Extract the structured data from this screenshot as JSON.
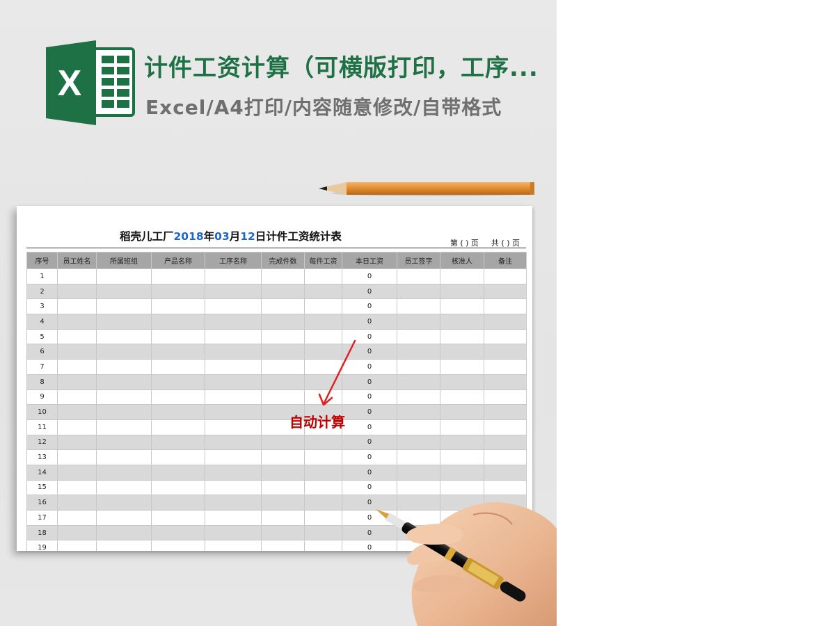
{
  "header": {
    "logo_letter": "X",
    "title": "计件工资计算（可横版打印，工序...",
    "subtitle": "Excel/A4打印/内容随意修改/自带格式"
  },
  "sheet": {
    "title_parts": {
      "prefix": "稻壳儿工厂",
      "year": "2018",
      "year_unit": "年",
      "month": "03",
      "month_unit": "月",
      "day": "12",
      "suffix": "日计件工资统计表"
    },
    "page_label": "第 ( ) 页",
    "total_label": "共 ( ) 页",
    "columns": [
      "序号",
      "员工姓名",
      "所属班组",
      "产品名称",
      "工序名称",
      "完成件数",
      "每件工资",
      "本日工资",
      "员工签字",
      "核准人",
      "备注"
    ],
    "rows": [
      {
        "no": "1",
        "wage": "0"
      },
      {
        "no": "2",
        "wage": "0"
      },
      {
        "no": "3",
        "wage": "0"
      },
      {
        "no": "4",
        "wage": "0"
      },
      {
        "no": "5",
        "wage": "0"
      },
      {
        "no": "6",
        "wage": "0"
      },
      {
        "no": "7",
        "wage": "0"
      },
      {
        "no": "8",
        "wage": "0"
      },
      {
        "no": "9",
        "wage": "0"
      },
      {
        "no": "10",
        "wage": "0"
      },
      {
        "no": "11",
        "wage": "0"
      },
      {
        "no": "12",
        "wage": "0"
      },
      {
        "no": "13",
        "wage": "0"
      },
      {
        "no": "14",
        "wage": "0"
      },
      {
        "no": "15",
        "wage": "0"
      },
      {
        "no": "16",
        "wage": "0"
      },
      {
        "no": "17",
        "wage": "0"
      },
      {
        "no": "18",
        "wage": "0"
      },
      {
        "no": "19",
        "wage": "0"
      }
    ]
  },
  "annotation": {
    "label": "自动计算",
    "color": "#c00000"
  },
  "colors": {
    "excel_green": "#1e7145",
    "header_gray": "#a6a6a6",
    "stripe_gray": "#d9d9d9",
    "date_blue": "#1f66c9"
  },
  "icons": [
    "excel-logo-icon",
    "pencil-icon",
    "arrow-icon",
    "fountain-pen-icon"
  ]
}
